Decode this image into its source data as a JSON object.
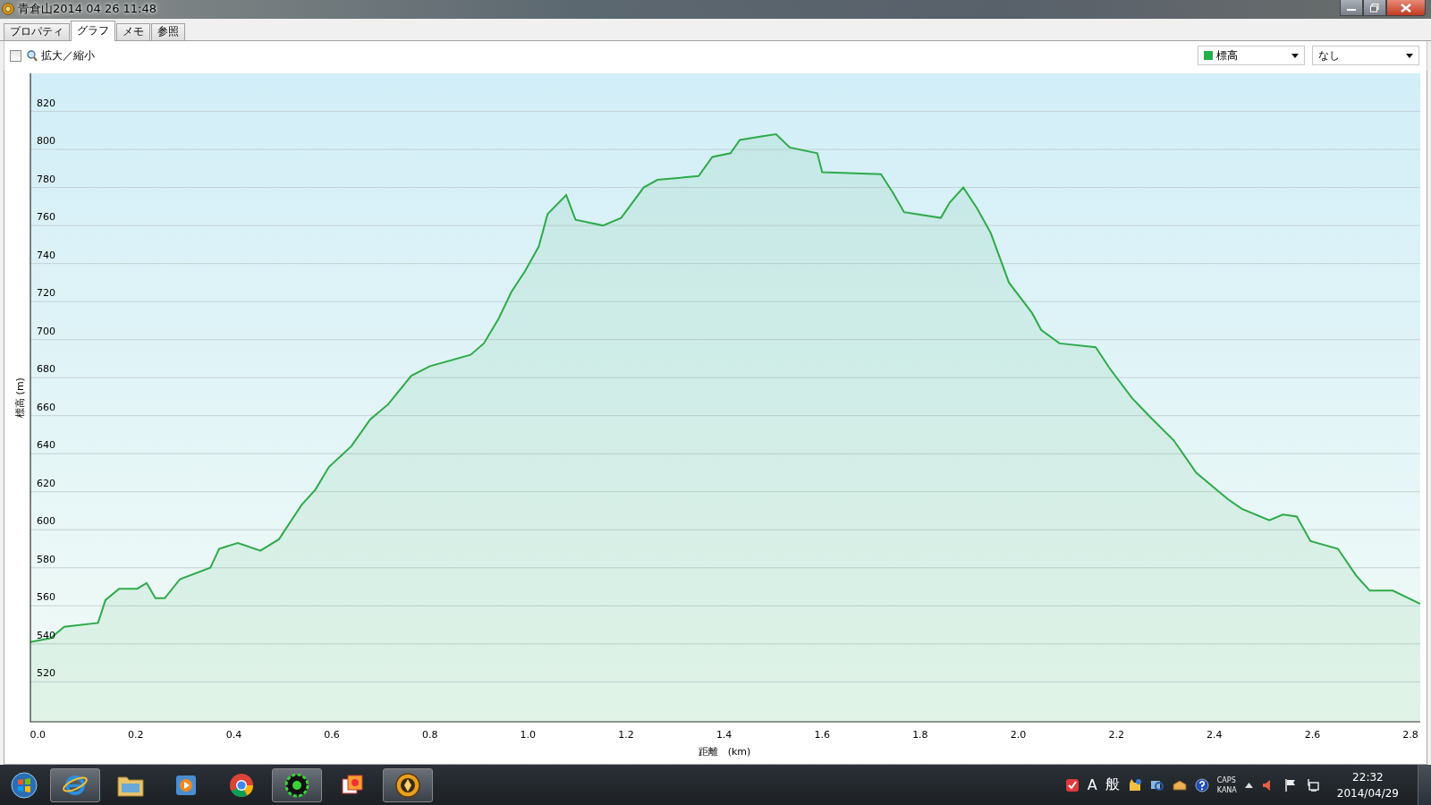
{
  "window": {
    "title": "青倉山2014 04 26 11:48"
  },
  "tabs": [
    {
      "label": "プロパティ",
      "selected": false
    },
    {
      "label": "グラフ",
      "selected": true
    },
    {
      "label": "メモ",
      "selected": false
    },
    {
      "label": "参照",
      "selected": false
    }
  ],
  "toolbar": {
    "zoom_checkbox": {
      "label": "拡大／縮小",
      "checked": false
    },
    "dropdowns": [
      {
        "value": "標高",
        "color": "#22b04a"
      },
      {
        "value": "なし"
      }
    ]
  },
  "chart": {
    "chart_data": {
      "type": "area",
      "grid": true,
      "xlabel": "距離　(km)",
      "ylabel": "標高 (m)",
      "xlim": [
        -0.015,
        2.82
      ],
      "ylim": [
        499,
        840
      ],
      "xticks": [
        {
          "value": 0,
          "label": "0.0"
        },
        {
          "value": 0.2,
          "label": "0.2"
        },
        {
          "value": 0.4,
          "label": "0.4"
        },
        {
          "value": 0.6,
          "label": "0.6"
        },
        {
          "value": 0.8,
          "label": "0.8"
        },
        {
          "value": 1,
          "label": "1.0"
        },
        {
          "value": 1.2,
          "label": "1.2"
        },
        {
          "value": 1.4,
          "label": "1.4"
        },
        {
          "value": 1.6,
          "label": "1.6"
        },
        {
          "value": 1.8,
          "label": "1.8"
        },
        {
          "value": 2,
          "label": "2.0"
        },
        {
          "value": 2.2,
          "label": "2.2"
        },
        {
          "value": 2.4,
          "label": "2.4"
        },
        {
          "value": 2.6,
          "label": "2.6"
        },
        {
          "value": 2.8,
          "label": "2.8"
        }
      ],
      "yticks": [
        520,
        540,
        560,
        580,
        600,
        620,
        640,
        660,
        680,
        700,
        720,
        740,
        760,
        780,
        800,
        820
      ],
      "x": [
        -0.015,
        0.026,
        0.054,
        0.123,
        0.138,
        0.166,
        0.203,
        0.222,
        0.24,
        0.259,
        0.29,
        0.352,
        0.37,
        0.408,
        0.454,
        0.492,
        0.52,
        0.538,
        0.566,
        0.594,
        0.64,
        0.678,
        0.715,
        0.762,
        0.8,
        0.883,
        0.91,
        0.94,
        0.966,
        0.994,
        1.022,
        1.04,
        1.078,
        1.097,
        1.153,
        1.19,
        1.236,
        1.264,
        1.348,
        1.376,
        1.413,
        1.432,
        1.479,
        1.506,
        1.534,
        1.59,
        1.6,
        1.72,
        1.745,
        1.767,
        1.842,
        1.86,
        1.888,
        1.916,
        1.944,
        1.981,
        2.028,
        2.047,
        2.084,
        2.158,
        2.186,
        2.233,
        2.27,
        2.317,
        2.363,
        2.428,
        2.456,
        2.512,
        2.54,
        2.568,
        2.596,
        2.652,
        2.689,
        2.717,
        2.764,
        2.82
      ],
      "series": [
        {
          "color": "#2eaa4a",
          "values": [
            541,
            543,
            549,
            551,
            563,
            569,
            569,
            572,
            564,
            564,
            574,
            580,
            590,
            593,
            589,
            595,
            606,
            613,
            621,
            633,
            644,
            658,
            666,
            681,
            686,
            692,
            698,
            711,
            725,
            736,
            749,
            766,
            776,
            763,
            760,
            764,
            780,
            784,
            786,
            796,
            798,
            805,
            807,
            808,
            801,
            798,
            788,
            787,
            777,
            767,
            764,
            772,
            780,
            769,
            756,
            730,
            714,
            705,
            698,
            696,
            685,
            669,
            659,
            647,
            630,
            616,
            611,
            605,
            608,
            607,
            594,
            590,
            576,
            568,
            568,
            561
          ]
        }
      ]
    }
  },
  "taskbar": {
    "apps": [
      {
        "kind": "ie",
        "running": true
      },
      {
        "kind": "folder",
        "running": false
      },
      {
        "kind": "media",
        "running": false
      },
      {
        "kind": "chrome",
        "running": false
      },
      {
        "kind": "gear",
        "running": true
      },
      {
        "kind": "photos",
        "running": false
      },
      {
        "kind": "compass",
        "running": true
      }
    ],
    "tray": {
      "ime_mode": "A",
      "ime_label": "般",
      "caps": "CAPS",
      "kana": "KANA"
    },
    "clock": {
      "time": "22:32",
      "date": "2014/04/29"
    }
  }
}
